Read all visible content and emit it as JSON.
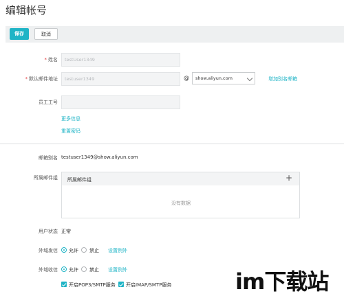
{
  "page": {
    "title": "编辑帐号"
  },
  "toolbar": {
    "save_label": "保存",
    "cancel_label": "取消"
  },
  "form": {
    "name": {
      "label": "姓名",
      "value": "testUser1349"
    },
    "default_email": {
      "label": "默认邮件地址",
      "value": "testuser1349",
      "at": "@",
      "domain": "show.aliyun.com",
      "add_alias_link": "增加别名邮箱"
    },
    "employee_id": {
      "label": "员工工号",
      "value": ""
    },
    "more_info_link": "更多信息",
    "reset_password_link": "重置密码"
  },
  "details": {
    "alias": {
      "label": "邮箱别名",
      "value": "testuser1349@show.aliyun.com"
    },
    "groups": {
      "label": "所属邮件组",
      "header": "所属邮件组",
      "empty": "没有数据",
      "add_icon": "plus-icon"
    },
    "user_status": {
      "label": "用户状态",
      "value": "正常"
    },
    "external_send": {
      "label": "外域发信",
      "allow": "允许",
      "deny": "禁止",
      "exceptions_link": "设置例外",
      "selected": "allow"
    },
    "external_receive": {
      "label": "外域收信",
      "allow": "允许",
      "deny": "禁止",
      "exceptions_link": "设置例外",
      "selected": "allow"
    },
    "pop3_smtp": "开启POP3/SMTP服务",
    "imap_smtp": "开启IMAP/SMTP服务"
  },
  "watermark": {
    "text": "im下载站"
  },
  "colors": {
    "accent": "#1fb4c6",
    "required": "#e4393c",
    "toolbar_bg": "#eef0f1"
  }
}
